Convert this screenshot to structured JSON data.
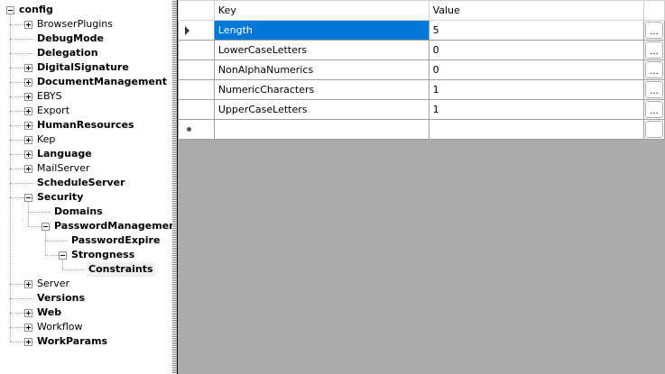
{
  "tree": [
    {
      "label": "config",
      "level": 0,
      "bold": true,
      "exp": "minus"
    },
    {
      "label": "BrowserPlugins",
      "level": 1,
      "bold": false,
      "exp": "plus"
    },
    {
      "label": "DebugMode",
      "level": 1,
      "bold": true,
      "exp": ""
    },
    {
      "label": "Delegation",
      "level": 1,
      "bold": true,
      "exp": ""
    },
    {
      "label": "DigitalSignature",
      "level": 1,
      "bold": true,
      "exp": "plus"
    },
    {
      "label": "DocumentManagement",
      "level": 1,
      "bold": true,
      "exp": "plus"
    },
    {
      "label": "EBYS",
      "level": 1,
      "bold": false,
      "exp": "plus"
    },
    {
      "label": "Export",
      "level": 1,
      "bold": false,
      "exp": "plus"
    },
    {
      "label": "HumanResources",
      "level": 1,
      "bold": true,
      "exp": "plus"
    },
    {
      "label": "Kep",
      "level": 1,
      "bold": false,
      "exp": "plus"
    },
    {
      "label": "Language",
      "level": 1,
      "bold": true,
      "exp": "plus"
    },
    {
      "label": "MailServer",
      "level": 1,
      "bold": false,
      "exp": "plus"
    },
    {
      "label": "ScheduleServer",
      "level": 1,
      "bold": true,
      "exp": ""
    },
    {
      "label": "Security",
      "level": 1,
      "bold": true,
      "exp": "minus"
    },
    {
      "label": "Domains",
      "level": 2,
      "bold": true,
      "exp": ""
    },
    {
      "label": "PasswordManagement",
      "level": 2,
      "bold": true,
      "exp": "minus"
    },
    {
      "label": "PasswordExpire",
      "level": 3,
      "bold": true,
      "exp": ""
    },
    {
      "label": "Strongness",
      "level": 3,
      "bold": true,
      "exp": "minus"
    },
    {
      "label": "Constraints",
      "level": 4,
      "bold": true,
      "exp": "",
      "selected": true
    },
    {
      "label": "Server",
      "level": 1,
      "bold": false,
      "exp": "plus"
    },
    {
      "label": "Versions",
      "level": 1,
      "bold": true,
      "exp": ""
    },
    {
      "label": "Web",
      "level": 1,
      "bold": true,
      "exp": "plus"
    },
    {
      "label": "Workflow",
      "level": 1,
      "bold": false,
      "exp": "plus"
    },
    {
      "label": "WorkParams",
      "level": 1,
      "bold": true,
      "exp": "plus"
    }
  ],
  "grid": {
    "headers": {
      "key": "Key",
      "value": "Value"
    },
    "button_label": "...",
    "rows": [
      {
        "key": "Length",
        "value": "5"
      },
      {
        "key": "LowerCaseLetters",
        "value": "0"
      },
      {
        "key": "NonAlphaNumerics",
        "value": "0"
      },
      {
        "key": "NumericCharacters",
        "value": "1"
      },
      {
        "key": "UpperCaseLetters",
        "value": "1"
      }
    ]
  },
  "colors": {
    "selection": "#0078d7",
    "empty_area": "#ababab"
  }
}
